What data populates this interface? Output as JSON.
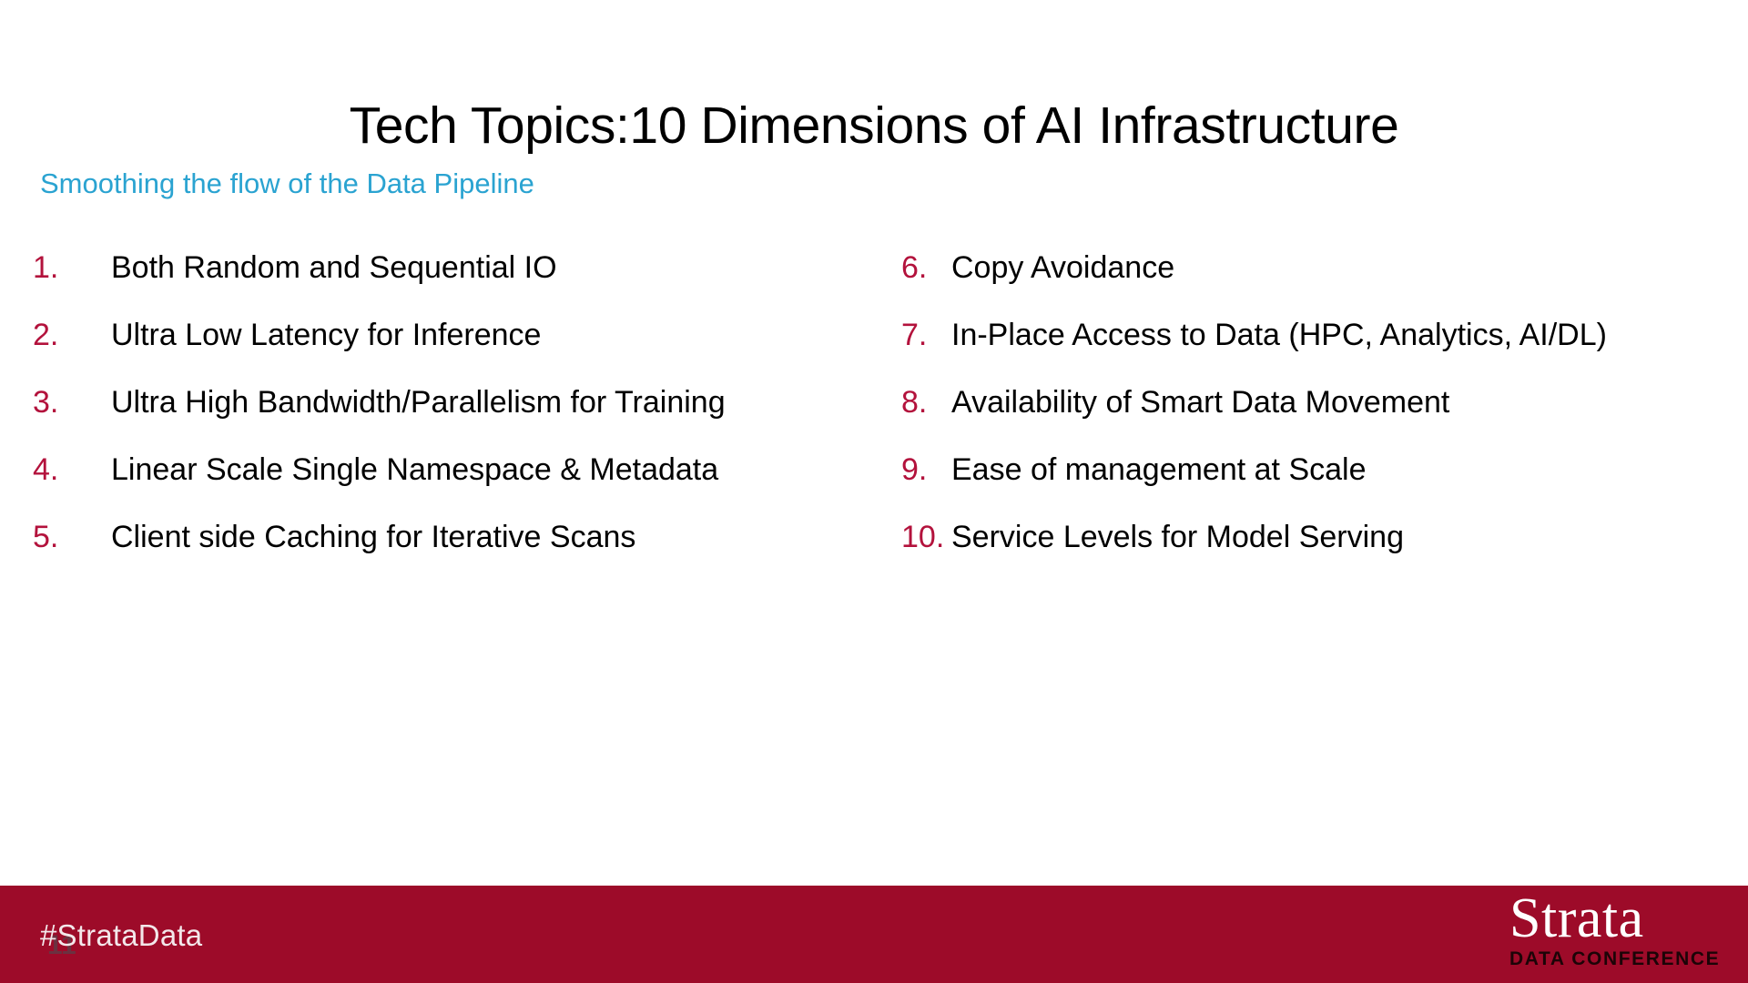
{
  "slide": {
    "title": "Tech Topics:10 Dimensions of AI Infrastructure",
    "subtitle": "Smoothing the flow of the Data Pipeline",
    "background_color": "#FFFFFF",
    "title_color": "#000000",
    "subtitle_color": "#2AA3D1",
    "number_color": "#B3123C",
    "footer_color": "#9D0B29"
  },
  "left_column": {
    "items": [
      {
        "number": "1.",
        "text": "Both Random and Sequential IO"
      },
      {
        "number": "2.",
        "text": "Ultra Low Latency for Inference"
      },
      {
        "number": "3.",
        "text": "Ultra High Bandwidth/Parallelism for Training"
      },
      {
        "number": "4.",
        "text": "Linear Scale Single Namespace & Metadata"
      },
      {
        "number": "5.",
        "text": "Client side Caching for Iterative Scans"
      }
    ]
  },
  "right_column": {
    "items": [
      {
        "number": "6.",
        "text": "Copy Avoidance"
      },
      {
        "number": "7.",
        "text": "In-Place Access to Data (HPC, Analytics, AI/DL)"
      },
      {
        "number": "8.",
        "text": "Availability of Smart Data Movement"
      },
      {
        "number": "9.",
        "text": "Ease of management at Scale"
      },
      {
        "number": "10.",
        "text": "Service Levels for Model Serving"
      }
    ]
  },
  "footer": {
    "hashtag": "#StrataData",
    "slide_number": "11",
    "logo_word": "Strata",
    "logo_subtitle": "DATA CONFERENCE"
  }
}
